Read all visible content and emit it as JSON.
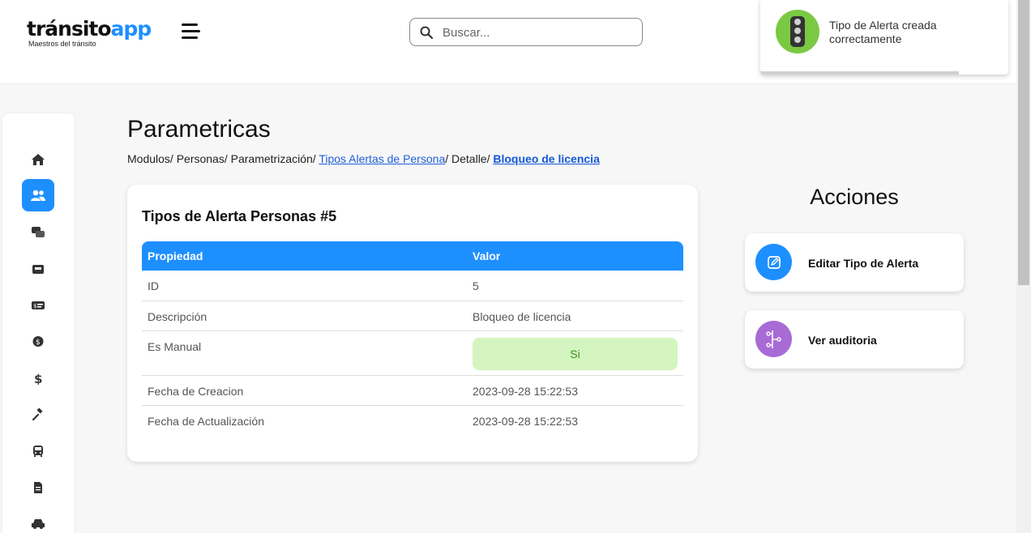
{
  "logo": {
    "brand_part1": "tránsito",
    "brand_part2": "app",
    "tagline": "Maestros del tránsito"
  },
  "search": {
    "placeholder": "Buscar..."
  },
  "toast": {
    "message": "Tipo de Alerta creada correctamente",
    "progress": 0.8
  },
  "sidebar": {
    "items": [
      {
        "icon": "home-icon",
        "active": false
      },
      {
        "icon": "users-icon",
        "active": true
      },
      {
        "icon": "chat-icon",
        "active": false
      },
      {
        "icon": "inbox-icon",
        "active": false
      },
      {
        "icon": "money-card-icon",
        "active": false
      },
      {
        "icon": "dollar-bubble-icon",
        "active": false
      },
      {
        "icon": "dollar-icon",
        "active": false
      },
      {
        "icon": "gavel-icon",
        "active": false
      },
      {
        "icon": "bus-icon",
        "active": false
      },
      {
        "icon": "document-icon",
        "active": false
      },
      {
        "icon": "car-icon",
        "active": false
      }
    ]
  },
  "page": {
    "title": "Parametricas"
  },
  "breadcrumb": {
    "item1": "Modulos/",
    "item2": "Personas/",
    "item3": "Parametrización/",
    "item4": "Tipos Alertas de Persona",
    "item5": "/ Detalle/",
    "item6": "Bloqueo de licencia"
  },
  "card": {
    "title": "Tipos de Alerta Personas #5",
    "headers": {
      "property": "Propiedad",
      "value": "Valor"
    },
    "rows": [
      {
        "property": "ID",
        "value": "5"
      },
      {
        "property": "Descripción",
        "value": "Bloqueo de licencia"
      },
      {
        "property": "Es Manual",
        "value": "Si"
      },
      {
        "property": "Fecha de Creacion",
        "value": "2023-09-28 15:22:53"
      },
      {
        "property": "Fecha de Actualización",
        "value": "2023-09-28 15:22:53"
      }
    ]
  },
  "actions": {
    "title": "Acciones",
    "edit_label": "Editar Tipo de Alerta",
    "audit_label": "Ver auditoria"
  },
  "colors": {
    "primary": "#1e8fff",
    "audit": "#a86bd6",
    "success_bg": "#d4f5c0",
    "success_text": "#3a8e1a",
    "toast_icon": "#7ac943"
  }
}
